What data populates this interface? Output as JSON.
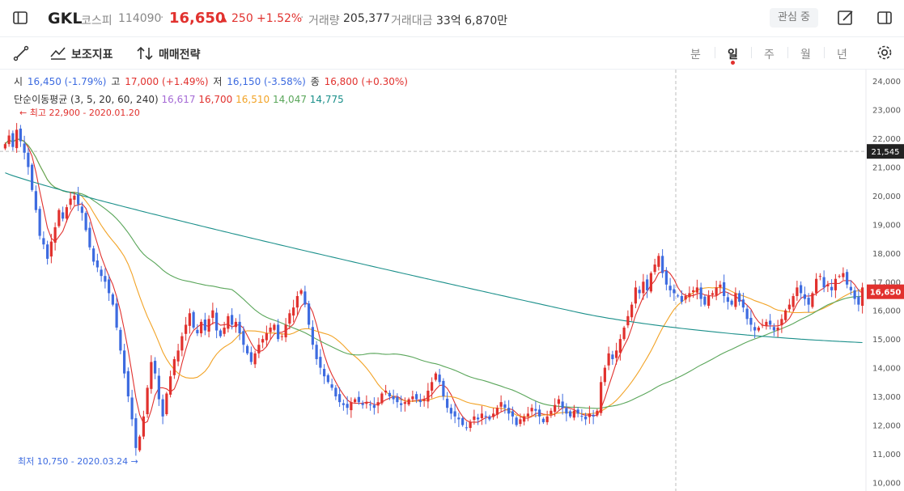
{
  "header": {
    "symbol": "GKL",
    "market": "코스피",
    "code": "114090",
    "price": "16,650",
    "change": "250",
    "change_pct": "+1.52%",
    "volume_label": "거래량",
    "volume": "205,377",
    "amount_label": "거래대금",
    "amount": "33억 6,870만",
    "fav_label": "관심 중"
  },
  "toolbar": {
    "indicator_label": "보조지표",
    "strategy_label": "매매전략",
    "periods": [
      "분",
      "일",
      "주",
      "월",
      "년"
    ],
    "active_period": "일"
  },
  "ohlc": {
    "open_label": "시",
    "open": "16,450 (-1.79%)",
    "high_label": "고",
    "high": "17,000 (+1.49%)",
    "low_label": "저",
    "low": "16,150 (-3.58%)",
    "close_label": "종",
    "close": "16,800 (+0.30%)"
  },
  "ma": {
    "label": "단순이동평균 (3, 5, 20, 60, 240)",
    "values": [
      "16,617",
      "16,700",
      "16,510",
      "14,047",
      "14,775"
    ],
    "colors": [
      "#a66bd6",
      "#e1312e",
      "#f2a326",
      "#5aa65a",
      "#1a8f8a"
    ]
  },
  "annotations": {
    "high_note": "최고 22,900 - 2020.01.20",
    "low_note": "최저 10,750 - 2020.03.24",
    "crosshair_price": "21,545",
    "last_price": "16,650"
  },
  "colors": {
    "up": "#e1312e",
    "down": "#3d6be0"
  },
  "chart_data": {
    "type": "candlestick",
    "ylim": [
      9700,
      24400
    ],
    "yticks": [
      10000,
      11000,
      12000,
      13000,
      14000,
      15000,
      16000,
      17000,
      18000,
      19000,
      20000,
      21000,
      22000,
      23000,
      24000
    ],
    "ytick_labels": [
      "10,000",
      "11,000",
      "12,000",
      "13,000",
      "14,000",
      "15,000",
      "16,000",
      "17,000",
      "18,000",
      "19,000",
      "20,000",
      "21,000",
      "22,000",
      "23,000",
      "24,000"
    ],
    "closes": [
      21800,
      22100,
      21700,
      22300,
      21900,
      21500,
      21000,
      20200,
      19500,
      18600,
      18300,
      17800,
      18400,
      18900,
      19500,
      19200,
      19600,
      19900,
      20000,
      19700,
      19400,
      18800,
      18200,
      17700,
      17500,
      17200,
      17000,
      16600,
      16200,
      15400,
      14600,
      13800,
      13000,
      12200,
      11200,
      11600,
      12300,
      13300,
      14200,
      13800,
      12900,
      12300,
      13100,
      13700,
      14300,
      14600,
      15100,
      15500,
      15900,
      15400,
      15200,
      15600,
      15300,
      15700,
      16000,
      15300,
      15100,
      15400,
      15800,
      15500,
      15600,
      15200,
      14800,
      14500,
      14200,
      14500,
      14800,
      15000,
      15200,
      15400,
      15500,
      15000,
      15100,
      15500,
      15900,
      16100,
      16500,
      16700,
      16200,
      15500,
      14800,
      14300,
      14000,
      13700,
      13500,
      13300,
      13000,
      12800,
      12700,
      12600,
      12800,
      12900,
      12800,
      12700,
      12800,
      12700,
      12600,
      12800,
      13100,
      13200,
      13000,
      12900,
      12800,
      12700,
      12800,
      12900,
      13000,
      12900,
      12800,
      12900,
      13200,
      13500,
      13800,
      13500,
      13000,
      12600,
      12400,
      12300,
      12200,
      12000,
      11900,
      12100,
      12300,
      12200,
      12400,
      12300,
      12200,
      12400,
      12600,
      12800,
      12600,
      12400,
      12300,
      12000,
      12200,
      12300,
      12400,
      12600,
      12500,
      12300,
      12100,
      12300,
      12500,
      12700,
      12900,
      12600,
      12400,
      12300,
      12500,
      12400,
      12300,
      12200,
      12400,
      12300,
      12500,
      13500,
      14000,
      14500,
      14300,
      14600,
      15000,
      15400,
      15800,
      16200,
      16800,
      16600,
      17000,
      16700,
      17300,
      17600,
      17900,
      17300,
      16900,
      16700,
      16600,
      16500,
      16300,
      16500,
      16600,
      16700,
      16800,
      16400,
      16200,
      16500,
      16600,
      16800,
      16900,
      16500,
      16300,
      16200,
      16600,
      16300,
      16100,
      15700,
      15500,
      15300,
      15400,
      15500,
      15600,
      15500,
      15300,
      15400,
      15700,
      16000,
      16200,
      16500,
      16800,
      16600,
      16400,
      16200,
      16600,
      17100,
      17200,
      16800,
      16900,
      16700,
      17100,
      17200,
      17300,
      16900,
      16700,
      16400,
      16200,
      16800
    ]
  }
}
